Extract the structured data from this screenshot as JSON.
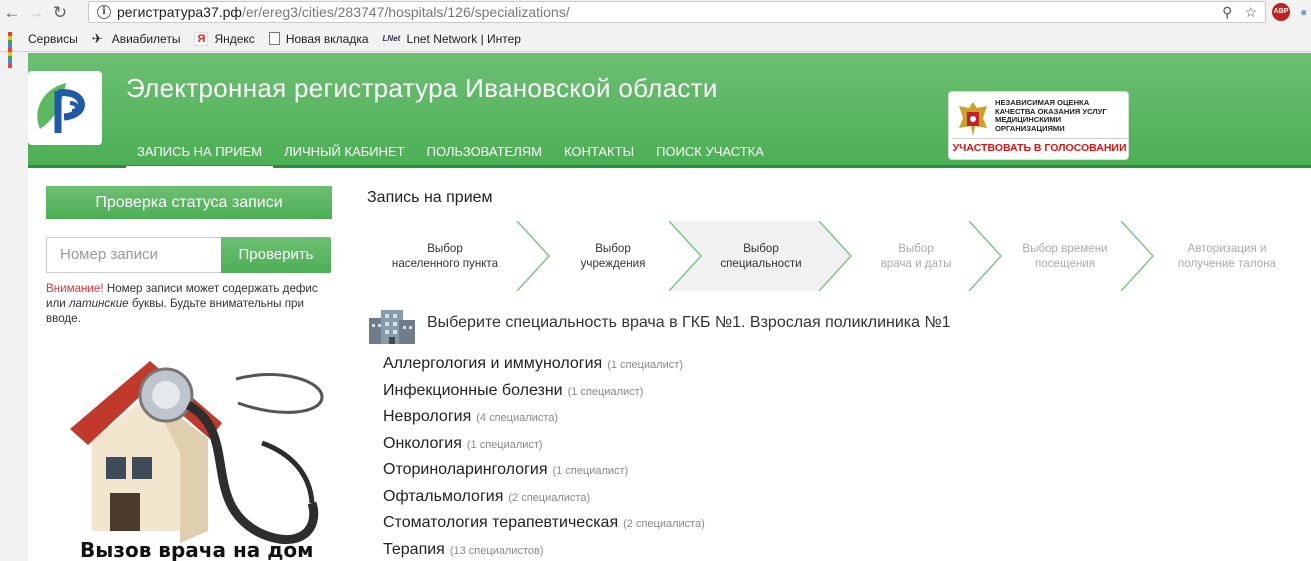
{
  "browser": {
    "url_host": "регистратура37.рф",
    "url_path": "/er/ereg3/cities/283747/hospitals/126/specializations/",
    "abp_label": "ABP",
    "bookmarks": [
      {
        "label": "Сервисы",
        "icon": "apps-icon"
      },
      {
        "label": "Авиабилеты",
        "icon": "plane-icon"
      },
      {
        "label": "Яндекс",
        "icon": "yandex-icon"
      },
      {
        "label": "Новая вкладка",
        "icon": "page-icon"
      },
      {
        "label": "Lnet Network | Интер",
        "icon": "lnet-icon"
      }
    ]
  },
  "header": {
    "title": "Электронная регистратура Ивановской области",
    "menu": [
      "ЗАПИСЬ НА ПРИЕМ",
      "ЛИЧНЫЙ КАБИНЕТ",
      "ПОЛЬЗОВАТЕЛЯМ",
      "КОНТАКТЫ",
      "ПОИСК УЧАСТКА"
    ],
    "active_menu": 0,
    "vote": {
      "lines": [
        "НЕЗАВИСИМАЯ ОЦЕНКА",
        "КАЧЕСТВА ОКАЗАНИЯ УСЛУГ",
        "МЕДИЦИНСКИМИ ОРГАНИЗАЦИЯМИ"
      ],
      "button": "УЧАСТВОВАТЬ В ГОЛОСОВАНИИ"
    }
  },
  "sidebar": {
    "status_button": "Проверка статуса записи",
    "record_placeholder": "Номер записи",
    "check_button": "Проверить",
    "notice_warn": "Внимание!",
    "notice_text_1": " Номер записи может содержать дефис или ",
    "notice_italic": "латинские",
    "notice_text_2": " буквы. Будьте внимательны при вводе.",
    "home_visit_caption": "Вызов врача на дом"
  },
  "main": {
    "title": "Запись на прием",
    "steps": [
      {
        "line1": "Выбор",
        "line2": "населенного пункта",
        "state": "done"
      },
      {
        "line1": "Выбор",
        "line2": "учреждения",
        "state": "done"
      },
      {
        "line1": "Выбор",
        "line2": "специальности",
        "state": "active"
      },
      {
        "line1": "Выбор",
        "line2": "врача и даты",
        "state": "pending"
      },
      {
        "line1": "Выбор времени",
        "line2": "посещения",
        "state": "pending"
      },
      {
        "line1": "Авторизация и",
        "line2": "получение талона",
        "state": "pending"
      }
    ],
    "choose_title": "Выберите специальность врача в ГКБ №1. Взрослая поликлиника №1",
    "specializations": [
      {
        "name": "Аллергология и иммунология",
        "count": "(1 специалист)"
      },
      {
        "name": "Инфекционные болезни",
        "count": "(1 специалист)"
      },
      {
        "name": "Неврология",
        "count": "(4 специалиста)"
      },
      {
        "name": "Онкология",
        "count": "(1 специалист)"
      },
      {
        "name": "Оториноларингология",
        "count": "(1 специалист)"
      },
      {
        "name": "Офтальмология",
        "count": "(2 специалиста)"
      },
      {
        "name": "Стоматология терапевтическая",
        "count": "(2 специалиста)"
      },
      {
        "name": "Терапия",
        "count": "(13 специалистов)"
      }
    ]
  },
  "colors": {
    "brand_green": "#4caf55",
    "warn_red": "#d33333"
  }
}
